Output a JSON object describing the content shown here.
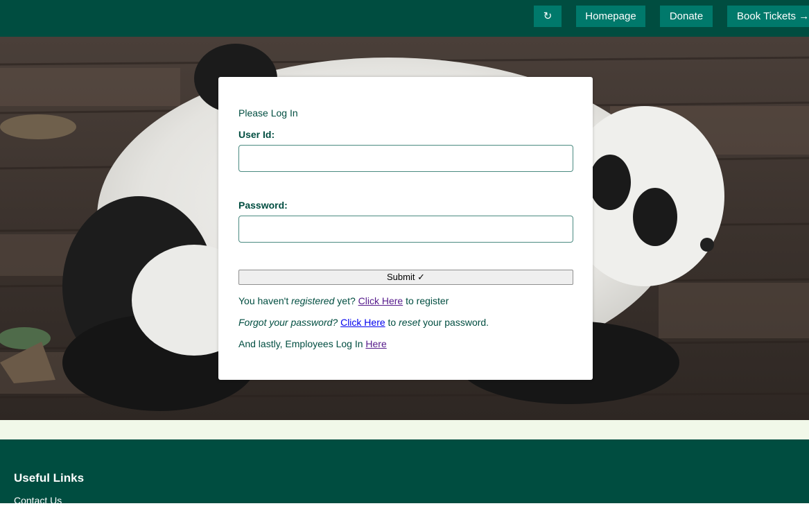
{
  "header": {
    "refresh_label": "↻",
    "homepage_label": "Homepage",
    "donate_label": "Donate",
    "book_label": "Book Tickets →"
  },
  "login": {
    "heading": "Please Log In",
    "user_label": "User Id:",
    "user_value": "",
    "password_label": "Password:",
    "password_value": "",
    "submit_label": "Submit ✓",
    "register": {
      "prefix": "You haven't ",
      "emph": "registered",
      "middle": " yet? ",
      "link": "Click Here",
      "suffix": " to register"
    },
    "forgot": {
      "emph": "Forgot your password?",
      "space": " ",
      "link": "Click Here",
      "to": " to ",
      "emph2": "reset",
      "suffix": " your password."
    },
    "employee": {
      "prefix": "And lastly, Employees Log In ",
      "link": "Here"
    }
  },
  "footer": {
    "heading": "Useful Links",
    "contact_link": "Contact Us"
  },
  "colors": {
    "primary_dark": "#004d40",
    "button_teal": "#00796b",
    "strip": "#f1f8e9"
  },
  "hero_image": "panda-cub-photo"
}
